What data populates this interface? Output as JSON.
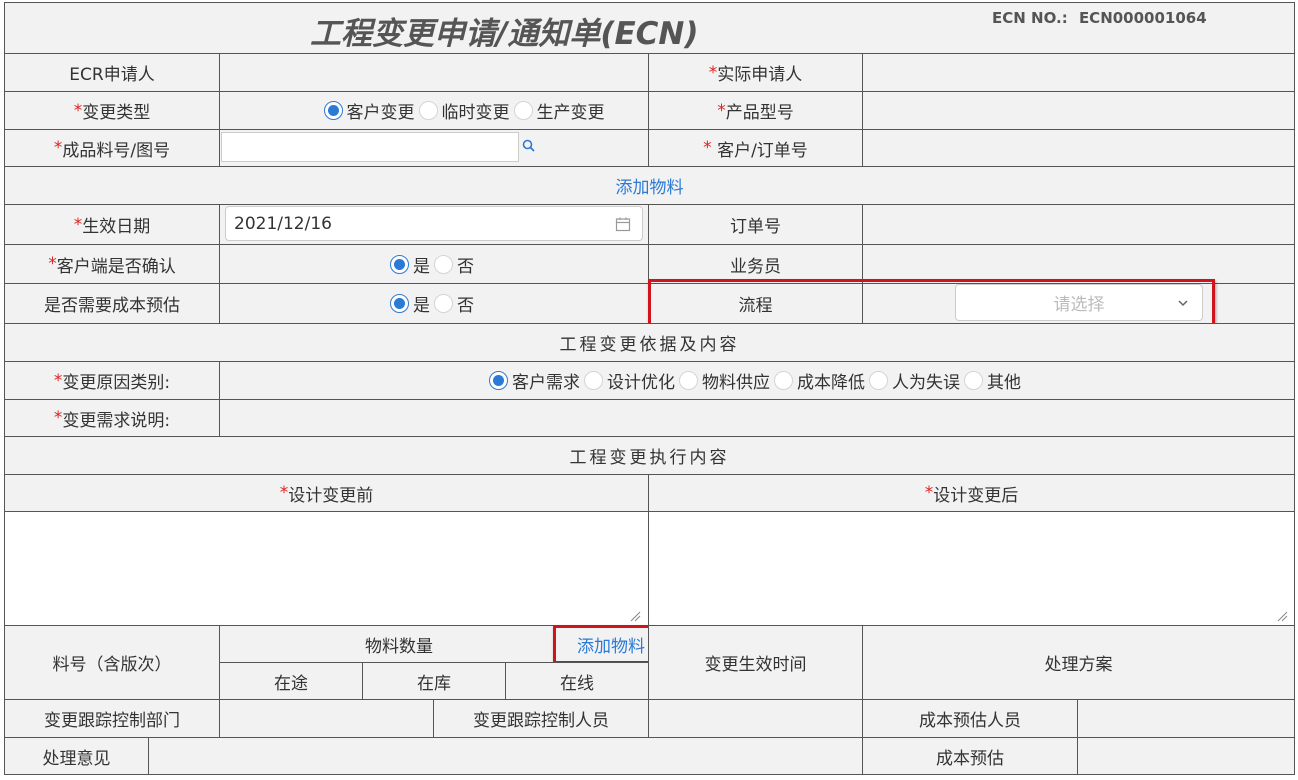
{
  "header": {
    "title": "工程变更申请/通知单(ECN)",
    "ecn_no_label": "ECN NO.:",
    "ecn_no_value": "ECN000001064"
  },
  "fields": {
    "ecr_applicant": "ECR申请人",
    "actual_applicant": "实际申请人",
    "change_type": "变更类型",
    "change_type_options": [
      "客户变更",
      "临时变更",
      "生产变更"
    ],
    "change_type_selected": "客户变更",
    "product_model": "产品型号",
    "finished_part_no": "成品料号/图号",
    "finished_part_value": "",
    "customer_order_no": " 客户/订单号",
    "add_material_link": "添加物料",
    "effective_date": "生效日期",
    "effective_date_value": "2021/12/16",
    "order_no": "订单号",
    "customer_confirm": "客户端是否确认",
    "yes": "是",
    "no": "否",
    "salesperson": "业务员",
    "need_cost_estimate": "是否需要成本预估",
    "process": "流程",
    "process_placeholder": "请选择"
  },
  "section_basis": {
    "title": "工程变更依据及内容",
    "reason_category": "变更原因类别:",
    "reason_options": [
      "客户需求",
      "设计优化",
      "物料供应",
      "成本降低",
      "人为失误",
      "其他"
    ],
    "reason_selected": "客户需求",
    "requirement_desc": "变更需求说明:"
  },
  "section_exec": {
    "title": "工程变更执行内容",
    "before": "设计变更前",
    "after": "设计变更后",
    "part_no_with_version": "料号（含版次）",
    "material_qty": "物料数量",
    "add_material_link": "添加物料",
    "in_transit": "在途",
    "in_stock": "在库",
    "on_line": "在线",
    "change_effective_time": "变更生效时间",
    "handling_plan": "处理方案",
    "tracking_dept": "变更跟踪控制部门",
    "tracking_person": "变更跟踪控制人员",
    "cost_estimator": "成本预估人员",
    "handling_opinion": "处理意见",
    "cost_estimate": "成本预估"
  },
  "colors": {
    "accent": "#2b7ad6",
    "required": "#e02020",
    "highlight_box": "#d0141b",
    "label_bg": "#f2f2f2"
  }
}
